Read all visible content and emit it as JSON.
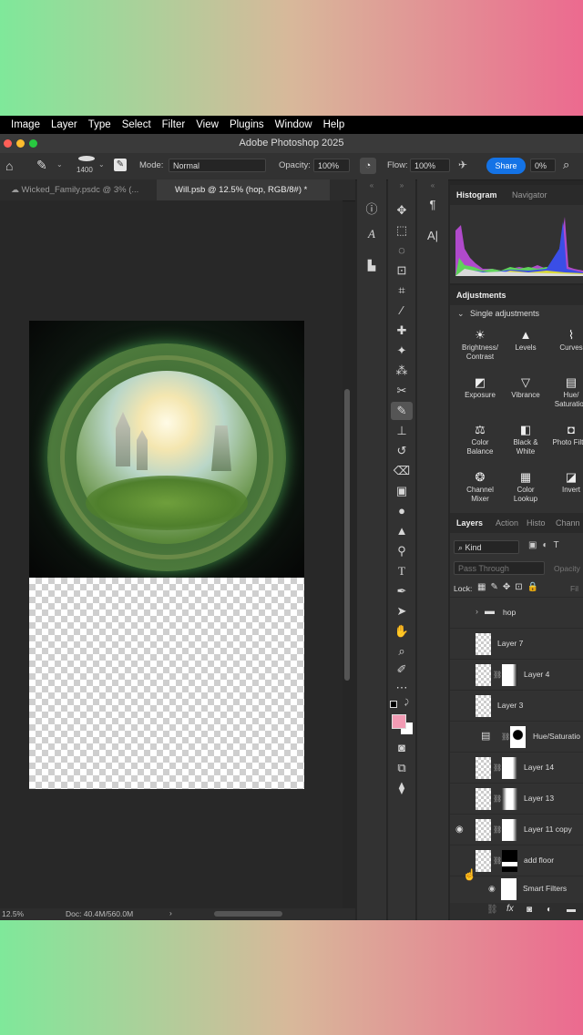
{
  "menu": [
    "Image",
    "Layer",
    "Type",
    "Select",
    "Filter",
    "View",
    "Plugins",
    "Window",
    "Help"
  ],
  "window_title": "Adobe Photoshop 2025",
  "options": {
    "brush_size": "1400",
    "mode_label": "Mode:",
    "mode_value": "Normal",
    "opacity_label": "Opacity:",
    "opacity_value": "100%",
    "flow_label": "Flow:",
    "flow_value": "100%",
    "share_label": "Share",
    "smoothing_value": "0%"
  },
  "tabs": [
    {
      "label": "Wicked_Family.psdc @ 3% (...",
      "active": false
    },
    {
      "label": "Will.psb @ 12.5% (hop, RGB/8#) *",
      "active": true
    }
  ],
  "status": {
    "zoom": "12.5%",
    "doc": "Doc: 40.4M/560.0M",
    "arrow": "›"
  },
  "histogram": {
    "tabs": [
      "Histogram",
      "Navigator"
    ]
  },
  "adjustments": {
    "title": "Adjustments",
    "section": "Single adjustments",
    "items": [
      {
        "label": "Brightness/ Contrast",
        "icon": "sun-icon"
      },
      {
        "label": "Levels",
        "icon": "levels-icon"
      },
      {
        "label": "Curves",
        "icon": "curves-icon"
      },
      {
        "label": "Exposure",
        "icon": "exposure-icon"
      },
      {
        "label": "Vibrance",
        "icon": "vibrance-icon"
      },
      {
        "label": "Hue/ Saturation",
        "icon": "hue-icon"
      },
      {
        "label": "Color Balance",
        "icon": "balance-icon"
      },
      {
        "label": "Black & White",
        "icon": "bw-icon"
      },
      {
        "label": "Photo Filter",
        "icon": "camera-icon"
      },
      {
        "label": "Channel Mixer",
        "icon": "mixer-icon"
      },
      {
        "label": "Color Lookup",
        "icon": "grid-icon"
      },
      {
        "label": "Invert",
        "icon": "invert-icon"
      }
    ]
  },
  "layers_panel": {
    "tabs": [
      "Layers",
      "Action",
      "Histo",
      "Chann"
    ],
    "kind": "Kind",
    "blend": "Pass Through",
    "opacity": "Opacity",
    "lock_label": "Lock:",
    "fill": "Fil",
    "layers": [
      {
        "name": "hop",
        "type": "group",
        "visible": false
      },
      {
        "name": "Layer 7",
        "type": "pixel",
        "visible": false
      },
      {
        "name": "Layer 4",
        "type": "masked",
        "visible": false
      },
      {
        "name": "Layer 3",
        "type": "pixel",
        "visible": false
      },
      {
        "name": "Hue/Saturatio",
        "type": "adjustment",
        "visible": false
      },
      {
        "name": "Layer 14",
        "type": "masked",
        "visible": false
      },
      {
        "name": "Layer 13",
        "type": "masked",
        "visible": false
      },
      {
        "name": "Layer 11 copy",
        "type": "masked",
        "visible": true
      },
      {
        "name": "add floor",
        "type": "smart",
        "visible": false
      },
      {
        "name": "Smart Filters",
        "type": "filter",
        "visible": true
      }
    ]
  },
  "colors": {
    "accent": "#1473e6",
    "foreground": "#f29bb4",
    "background": "#ffffff"
  }
}
